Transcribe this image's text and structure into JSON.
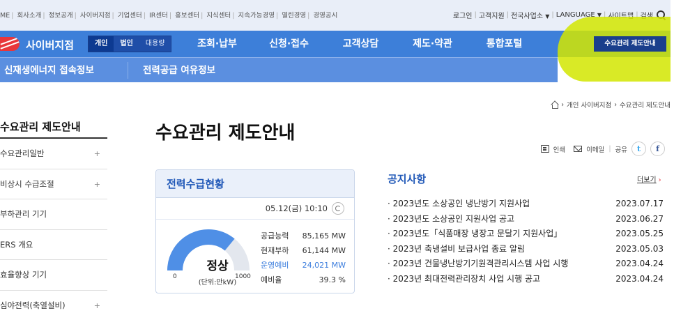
{
  "topbar": {
    "left_links": [
      "ME",
      "회사소개",
      "정보공개",
      "사이버지점",
      "기업센터",
      "IR센터",
      "홍보센터",
      "지식센터",
      "지속가능경영",
      "열린경영",
      "경영공시"
    ],
    "login": "로그인",
    "customer_support": "고객지원",
    "business_sites": "전국사업소",
    "language": "LANGUAGE",
    "sitemap": "사이트맵",
    "search": "검색"
  },
  "mainnav": {
    "brand": "사이버지점",
    "segments": [
      "개인",
      "법인",
      "대용량"
    ],
    "items": [
      "조회·납부",
      "신청·접수",
      "고객상담",
      "제도·약관",
      "통합포털"
    ],
    "notice_button": "수요관리 제도안내"
  },
  "subnav": {
    "items": [
      "신재생에너지 접속정보",
      "전력공급 여유정보"
    ]
  },
  "breadcrumb": {
    "items": [
      "개인 사이버지점",
      "수요관리 제도안내"
    ]
  },
  "sidebar": {
    "title": "수요관리 제도안내",
    "items": [
      {
        "label": "수요관리일반",
        "expandable": "+"
      },
      {
        "label": "비상시 수급조절",
        "expandable": "+"
      },
      {
        "label": "부하관리 기기",
        "expandable": ""
      },
      {
        "label": "ERS 개요",
        "expandable": ""
      },
      {
        "label": "효율향상 기기",
        "expandable": ""
      },
      {
        "label": "심야전력(축열설비)",
        "expandable": "+"
      }
    ]
  },
  "page": {
    "title": "수요관리 제도안내",
    "print": "인쇄",
    "email": "이메일",
    "share": "공유"
  },
  "power_card": {
    "title": "전력수급현황",
    "timestamp": "05.12(금) 10:10",
    "status": "정상",
    "unit": "(단위:만kW)",
    "gauge_min": "0",
    "gauge_max": "1000",
    "gauge_fraction": 0.72,
    "stats": [
      {
        "label": "공급능력",
        "value": "85,165 MW",
        "highlight": false
      },
      {
        "label": "현재부하",
        "value": "61,144 MW",
        "highlight": false
      },
      {
        "label": "운영예비",
        "value": "24,021 MW",
        "highlight": true
      },
      {
        "label": "예비율",
        "value": "39.3 %",
        "highlight": false
      }
    ]
  },
  "notices": {
    "title": "공지사항",
    "more": "더보기",
    "items": [
      {
        "text": "· 2023년도 소상공인 냉난방기 지원사업",
        "date": "2023.07.17"
      },
      {
        "text": "· 2023년도 소상공인 지원사업 공고",
        "date": "2023.06.27"
      },
      {
        "text": "· 2023년도「식품매장 냉장고 문달기 지원사업」",
        "date": "2023.05.25"
      },
      {
        "text": "· 2023년 축냉설비 보급사업 종료 알림",
        "date": "2023.05.03"
      },
      {
        "text": "· 2023년 건물냉난방기기원격관리시스템 사업 시행",
        "date": "2023.04.24"
      },
      {
        "text": "· 2023년 최대전력관리장치 사업 시행 공고",
        "date": "2023.04.24"
      }
    ]
  },
  "colors": {
    "nav_blue": "#3d7fd9",
    "subnav_blue": "#5b8fe0",
    "title_blue": "#1f57b7",
    "highlight_yellow": "#d2e600",
    "gauge_blue": "#4f8fe6",
    "brand_red": "#e8363b"
  }
}
